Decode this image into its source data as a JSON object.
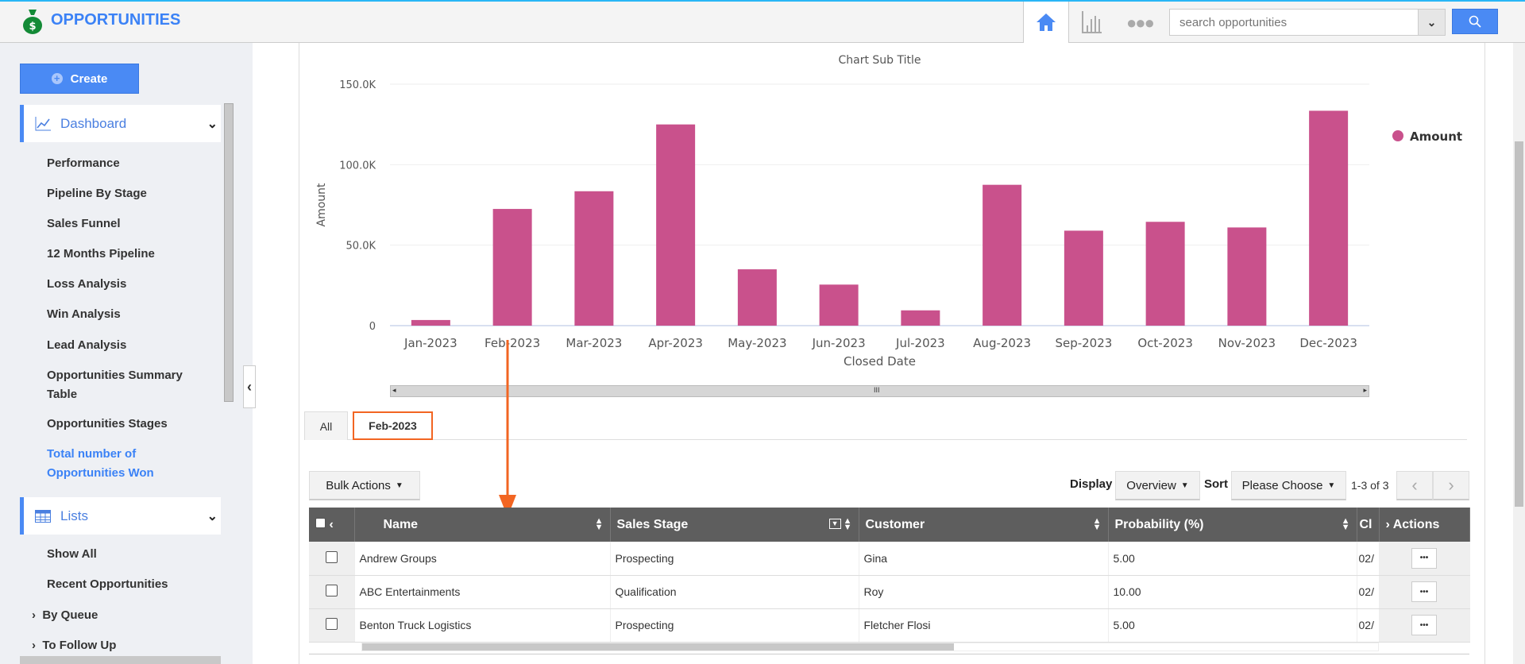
{
  "header": {
    "title": "OPPORTUNITIES",
    "search_placeholder": "search opportunities",
    "icons": [
      "money-bag-icon",
      "home-icon",
      "bar-chart-icon",
      "more-icon",
      "chevron-down-icon",
      "search-icon"
    ]
  },
  "sidebar": {
    "create_label": "Create",
    "dashboard": {
      "label": "Dashboard",
      "items": [
        "Performance",
        "Pipeline By Stage",
        "Sales Funnel",
        "12 Months Pipeline",
        "Loss Analysis",
        "Win Analysis",
        "Lead Analysis",
        "Opportunities Summary Table",
        "Opportunities Stages",
        "Total number of Opportunities Won"
      ],
      "active": "Total number of Opportunities Won"
    },
    "lists": {
      "label": "Lists",
      "items": [
        "Show All",
        "Recent Opportunities"
      ],
      "groups": [
        "By Queue",
        "To Follow Up"
      ]
    }
  },
  "chart_data": {
    "type": "bar",
    "subtitle": "Chart Sub Title",
    "xlabel": "Closed Date",
    "ylabel": "Amount",
    "ylim": [
      0,
      150000
    ],
    "yticks": [
      "0",
      "50.0K",
      "100.0K",
      "150.0K"
    ],
    "grid": true,
    "legend_placement": "right",
    "color": "#c9518c",
    "categories": [
      "Jan-2023",
      "Feb-2023",
      "Mar-2023",
      "Apr-2023",
      "May-2023",
      "Jun-2023",
      "Jul-2023",
      "Aug-2023",
      "Sep-2023",
      "Oct-2023",
      "Nov-2023",
      "Dec-2023"
    ],
    "series": [
      {
        "name": "Amount",
        "values": [
          3500,
          72500,
          83500,
          125000,
          35000,
          25500,
          9500,
          87500,
          59000,
          64500,
          61000,
          133500
        ]
      }
    ]
  },
  "tabs": [
    {
      "label": "All"
    },
    {
      "label": "Feb-2023",
      "active": true
    }
  ],
  "toolbar": {
    "bulk_actions": "Bulk Actions",
    "display_label": "Display",
    "display_value": "Overview",
    "sort_label": "Sort",
    "sort_value": "Please Choose",
    "pagination": "1-3 of 3"
  },
  "table": {
    "columns": [
      "Name",
      "Sales Stage",
      "Customer",
      "Probability (%)",
      "Cl",
      "Actions"
    ],
    "rows": [
      {
        "name": "Andrew Groups",
        "stage": "Prospecting",
        "customer": "Gina",
        "probability": "5.00",
        "cl": "02/"
      },
      {
        "name": "ABC Entertainments",
        "stage": "Qualification",
        "customer": "Roy",
        "probability": "10.00",
        "cl": "02/"
      },
      {
        "name": "Benton Truck Logistics",
        "stage": "Prospecting",
        "customer": "Fletcher Flosi",
        "probability": "5.00",
        "cl": "02/"
      }
    ]
  },
  "accent": "#4a8af4",
  "highlight": "#f26522"
}
